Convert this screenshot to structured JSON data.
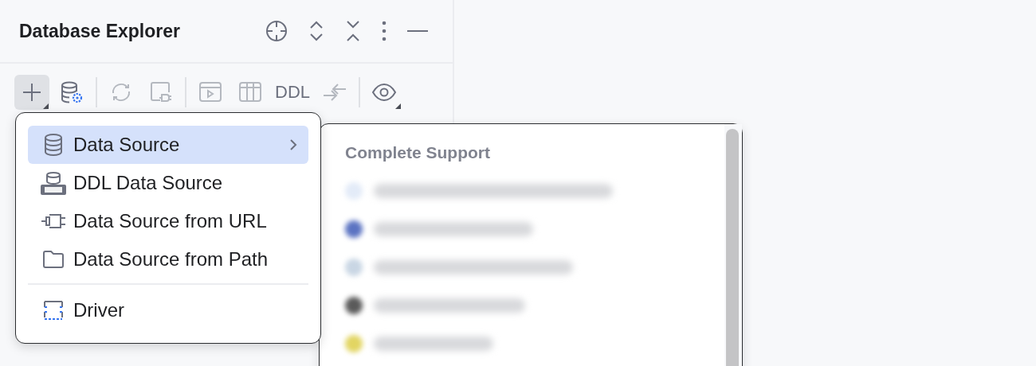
{
  "panel": {
    "title": "Database Explorer"
  },
  "toolbar": [
    [
      {
        "pressed": true,
        "disabled": false,
        "has_menu": true
      },
      {
        "pressed": false,
        "disabled": false,
        "has_menu": false
      }
    ],
    [
      {
        "pressed": false,
        "disabled": true,
        "has_menu": false
      },
      {
        "pressed": false,
        "disabled": true,
        "has_menu": false
      }
    ],
    [
      {
        "pressed": false,
        "disabled": true,
        "has_menu": false
      },
      {
        "pressed": false,
        "disabled": true,
        "has_menu": false
      },
      {
        "label": "DDL",
        "pressed": false,
        "disabled": false,
        "has_menu": false
      },
      {
        "pressed": false,
        "disabled": true,
        "has_menu": false
      }
    ],
    [
      {
        "pressed": false,
        "disabled": false,
        "has_menu": true
      }
    ]
  ],
  "menu": {
    "sections": [
      [
        {
          "label": "Data Source",
          "selected": true,
          "submenu": true
        },
        {
          "label": "DDL Data Source",
          "selected": false,
          "submenu": false
        },
        {
          "label": "Data Source from URL",
          "selected": false,
          "submenu": false
        },
        {
          "label": "Data Source from Path",
          "selected": false,
          "submenu": false
        }
      ],
      [
        {
          "label": "Driver",
          "selected": false,
          "submenu": false
        }
      ]
    ]
  },
  "submenu": {
    "heading": "Complete Support",
    "blurred_items": [
      {
        "color": "#e3ebf8"
      },
      {
        "color": "#5b73c2"
      },
      {
        "color": "#c9d6e4"
      },
      {
        "color": "#5a5a5a"
      },
      {
        "color": "#e2d562"
      }
    ]
  }
}
